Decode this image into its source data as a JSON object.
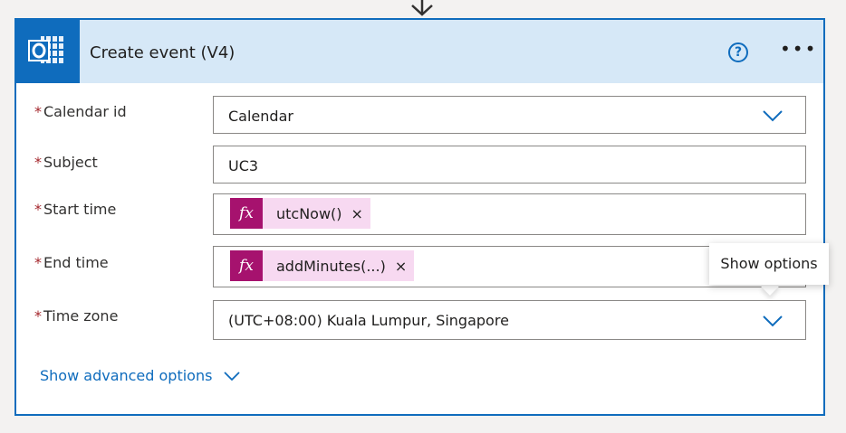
{
  "action": {
    "title": "Create event (V4)",
    "app_icon": "outlook-icon",
    "accent_color": "#0f6cbd",
    "header_color": "#d6e8f7"
  },
  "fields": {
    "calendar_id": {
      "required_mark": "*",
      "label": "Calendar id",
      "value": "Calendar"
    },
    "subject": {
      "required_mark": "*",
      "label": "Subject",
      "value": "UC3"
    },
    "start_time": {
      "required_mark": "*",
      "label": "Start time",
      "token_icon": "fx",
      "token_label": "utcNow()",
      "token_close": "×"
    },
    "end_time": {
      "required_mark": "*",
      "label": "End time",
      "token_icon": "fx",
      "token_label": "addMinutes(...)",
      "token_close": "×"
    },
    "time_zone": {
      "required_mark": "*",
      "label": "Time zone",
      "value": "(UTC+08:00) Kuala Lumpur, Singapore"
    }
  },
  "advanced_link": "Show advanced options",
  "tooltip": "Show options",
  "token_color": "#a6126e"
}
